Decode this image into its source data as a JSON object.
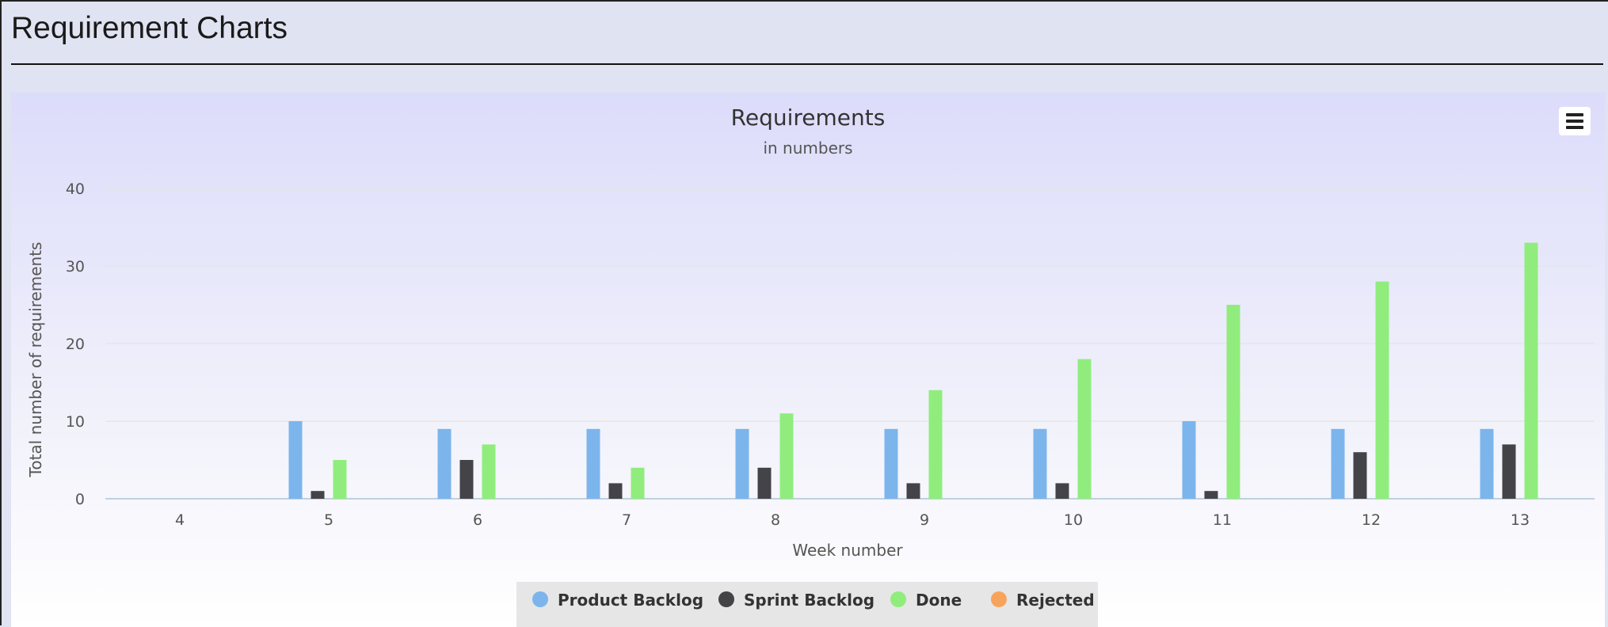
{
  "page": {
    "title": "Requirement Charts"
  },
  "chart_data": {
    "type": "bar",
    "title": "Requirements",
    "subtitle": "in numbers",
    "xlabel": "Week number",
    "ylabel": "Total number of requirements",
    "categories": [
      "4",
      "5",
      "6",
      "7",
      "8",
      "9",
      "10",
      "11",
      "12",
      "13"
    ],
    "ylim": [
      0,
      40
    ],
    "yticks": [
      0,
      10,
      20,
      30,
      40
    ],
    "grid": true,
    "legend_position": "bottom-center",
    "series": [
      {
        "name": "Product Backlog",
        "color": "#7cb5ec",
        "values": [
          0,
          10,
          9,
          9,
          9,
          9,
          9,
          10,
          9,
          9
        ]
      },
      {
        "name": "Sprint Backlog",
        "color": "#434348",
        "values": [
          0,
          1,
          5,
          2,
          4,
          2,
          2,
          1,
          6,
          7
        ]
      },
      {
        "name": "Done",
        "color": "#90ed7d",
        "values": [
          0,
          5,
          7,
          4,
          11,
          14,
          18,
          25,
          28,
          33
        ]
      },
      {
        "name": "Rejected",
        "color": "#f7a35c",
        "values": [
          0,
          0,
          0,
          0,
          0,
          0,
          0,
          0,
          0,
          0
        ]
      }
    ]
  },
  "toolbar": {
    "menu_icon": "hamburger-menu-icon"
  }
}
